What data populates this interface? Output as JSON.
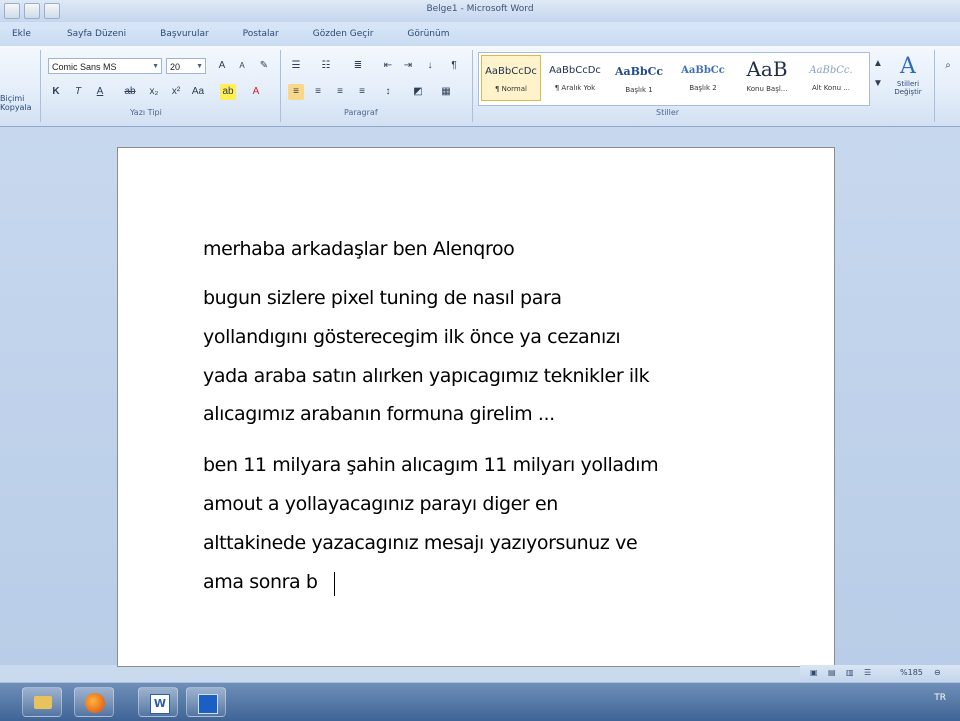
{
  "window": {
    "title": "Belge1 - Microsoft Word"
  },
  "tabs": [
    "Ekle",
    "Sayfa Düzeni",
    "Başvurular",
    "Postalar",
    "Gözden Geçir",
    "Görünüm"
  ],
  "ribbon": {
    "left_label": "Biçimi\nKopyala",
    "font_name": "Comic Sans MS",
    "font_size": "20",
    "font_group_label": "Yazı Tipi",
    "paragraph_group_label": "Paragraf",
    "styles_group_label": "Stiller",
    "styles": [
      {
        "sample": "AaBbCcDc",
        "name": "¶ Normal"
      },
      {
        "sample": "AaBbCcDc",
        "name": "¶ Aralık Yok"
      },
      {
        "sample": "AaBbCc",
        "name": "Başlık 1"
      },
      {
        "sample": "AaBbCc",
        "name": "Başlık 2"
      },
      {
        "sample": "AaB",
        "name": "Konu Başl..."
      },
      {
        "sample": "AaBbCc.",
        "name": "Alt Konu ..."
      }
    ],
    "change_styles_label": "Stilleri Değiştir"
  },
  "document": {
    "lines": [
      "merhaba arkadaşlar ben Alenqroo",
      "bugun sizlere pixel tuning de nasıl para",
      "yollandıgını gösterecegim ilk önce ya cezanızı",
      "yada araba satın alırken yapıcagımız teknikler ilk",
      "alıcagımız arabanın formuna girelim ...",
      "ben 11 milyara şahin alıcagım 11 milyarı yolladım",
      "amout a yollayacagınız parayı diger en",
      "alttakinede yazacagınız mesajı yazıyorsunuz ve",
      "ama sonra b"
    ]
  },
  "status": {
    "zoom": "%185"
  },
  "taskbar": {
    "tray": "TR"
  }
}
